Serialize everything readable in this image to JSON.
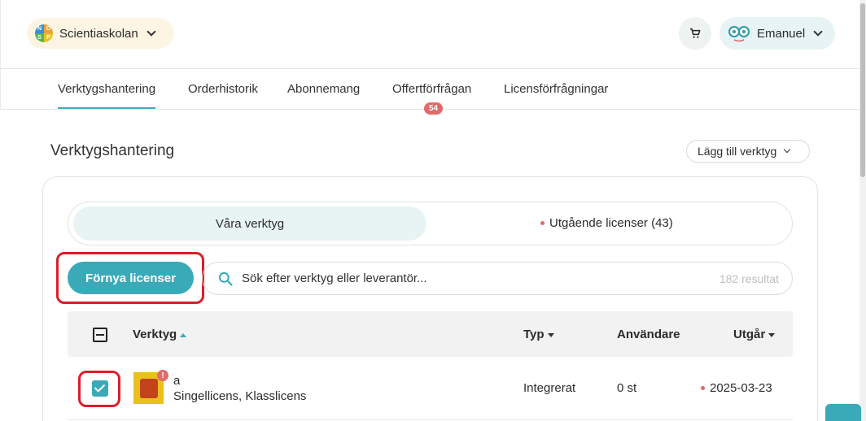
{
  "header": {
    "school_name": "Scientiaskolan",
    "user_name": "Emanuel"
  },
  "tabs": [
    {
      "label": "Verktygshantering",
      "active": true
    },
    {
      "label": "Orderhistorik",
      "active": false
    },
    {
      "label": "Abonnemang",
      "active": false
    },
    {
      "label": "Offertförfrågan",
      "active": false,
      "badge": "54"
    },
    {
      "label": "Licensförfrågningar",
      "active": false
    }
  ],
  "page": {
    "title": "Verktygshantering",
    "add_tool_label": "Lägg till verktyg"
  },
  "segments": {
    "active_label": "Våra verktyg",
    "other_label": "Utgående licenser (43)"
  },
  "actions": {
    "renew_label": "Förnya licenser"
  },
  "search": {
    "placeholder": "Sök efter verktyg eller leverantör...",
    "result_count": "182 resultat"
  },
  "table": {
    "headers": {
      "tool": "Verktyg",
      "type": "Typ",
      "users": "Användare",
      "expires": "Utgår"
    },
    "rows": [
      {
        "name": "a",
        "license": "Singellicens, Klasslicens",
        "type": "Integrerat",
        "users": "0 st",
        "expires": "2025-03-23",
        "checked": true
      }
    ]
  },
  "colors": {
    "accent": "#3aaab8",
    "warning": "#e06b6b",
    "highlight": "#d8202a"
  }
}
